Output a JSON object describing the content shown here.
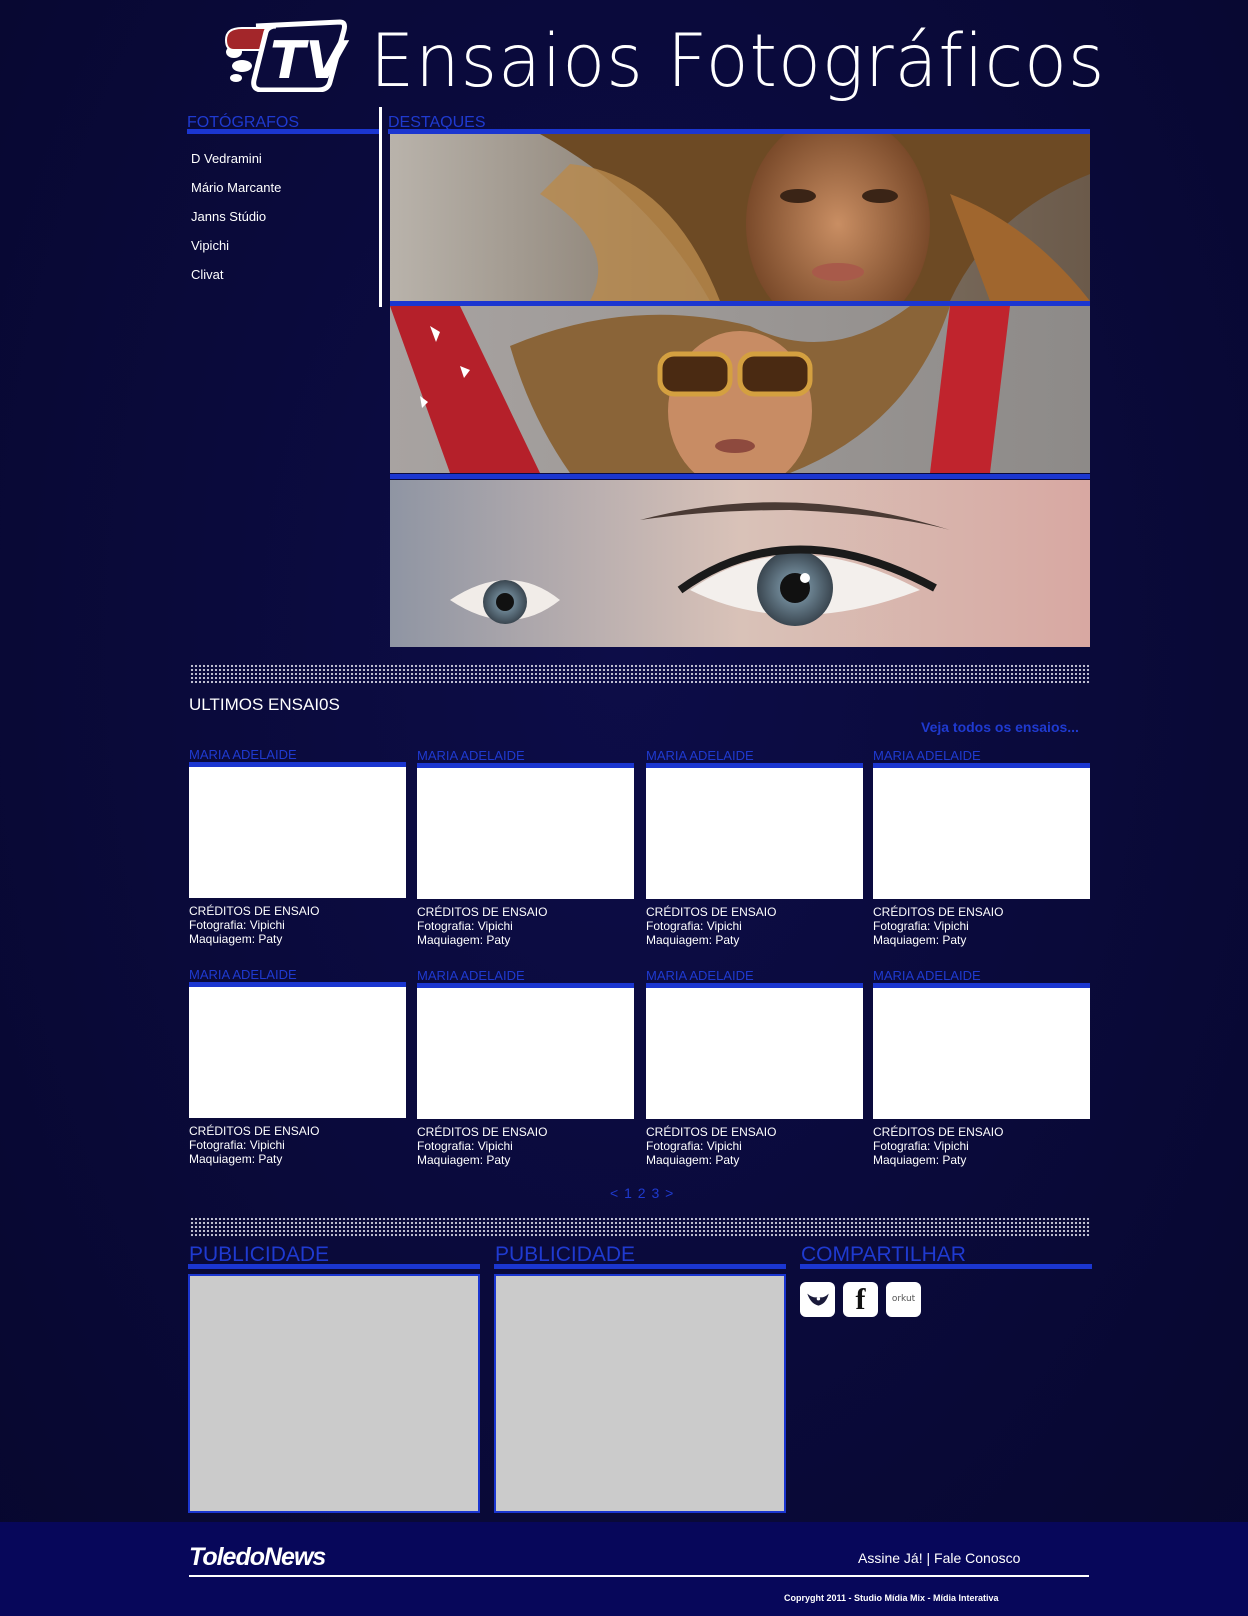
{
  "header": {
    "title": "Ensaios Fotográficos",
    "logo_text": "TV"
  },
  "sidebar": {
    "heading": "FOTÓGRAFOS",
    "items": [
      "D Vedramini",
      "Mário Marcante",
      "Janns Stúdio",
      "Vipichi",
      "Clivat"
    ]
  },
  "highlights": {
    "heading": "DESTAQUES"
  },
  "latest": {
    "heading": "ULTIMOS ENSAI0S",
    "see_all": "Veja todos os ensaios...",
    "cards": [
      {
        "title": "MARIA ADELAIDE",
        "credits_heading": "CRÉDITOS DE ENSAIO",
        "photo": "Fotografia: Vipichi",
        "makeup": "Maquiagem: Paty"
      },
      {
        "title": "MARIA ADELAIDE",
        "credits_heading": "CRÉDITOS DE ENSAIO",
        "photo": "Fotografia: Vipichi",
        "makeup": "Maquiagem: Paty"
      },
      {
        "title": "MARIA ADELAIDE",
        "credits_heading": "CRÉDITOS DE ENSAIO",
        "photo": "Fotografia: Vipichi",
        "makeup": "Maquiagem: Paty"
      },
      {
        "title": "MARIA ADELAIDE",
        "credits_heading": "CRÉDITOS DE ENSAIO",
        "photo": "Fotografia: Vipichi",
        "makeup": "Maquiagem: Paty"
      },
      {
        "title": "MARIA ADELAIDE",
        "credits_heading": "CRÉDITOS DE ENSAIO",
        "photo": "Fotografia: Vipichi",
        "makeup": "Maquiagem: Paty"
      },
      {
        "title": "MARIA ADELAIDE",
        "credits_heading": "CRÉDITOS DE ENSAIO",
        "photo": "Fotografia: Vipichi",
        "makeup": "Maquiagem: Paty"
      },
      {
        "title": "MARIA ADELAIDE",
        "credits_heading": "CRÉDITOS DE ENSAIO",
        "photo": "Fotografia: Vipichi",
        "makeup": "Maquiagem: Paty"
      },
      {
        "title": "MARIA ADELAIDE",
        "credits_heading": "CRÉDITOS DE ENSAIO",
        "photo": "Fotografia: Vipichi",
        "makeup": "Maquiagem: Paty"
      }
    ],
    "pager": {
      "prev": "<",
      "pages": [
        "1",
        "2",
        "3"
      ],
      "next": ">"
    }
  },
  "ads": {
    "heading_1": "PUBLICIDADE",
    "heading_2": "PUBLICIDADE"
  },
  "share": {
    "heading": "COMPARTILHAR",
    "icons": [
      "twitter-icon",
      "facebook-icon",
      "orkut-icon"
    ],
    "facebook_letter": "f",
    "orkut_text": "orkut"
  },
  "footer": {
    "brand": "ToledoNews",
    "subscribe": "Assine Já!",
    "separator": "|",
    "contact": "Fale Conosco",
    "copyright": "Copryght 2011 - Studio Mídia Mix - Mídia Interativa"
  },
  "colors": {
    "background": "#0b0b3c",
    "accent": "#1b36d0",
    "footer": "#07075a",
    "ad_placeholder": "#cbcbcb"
  }
}
